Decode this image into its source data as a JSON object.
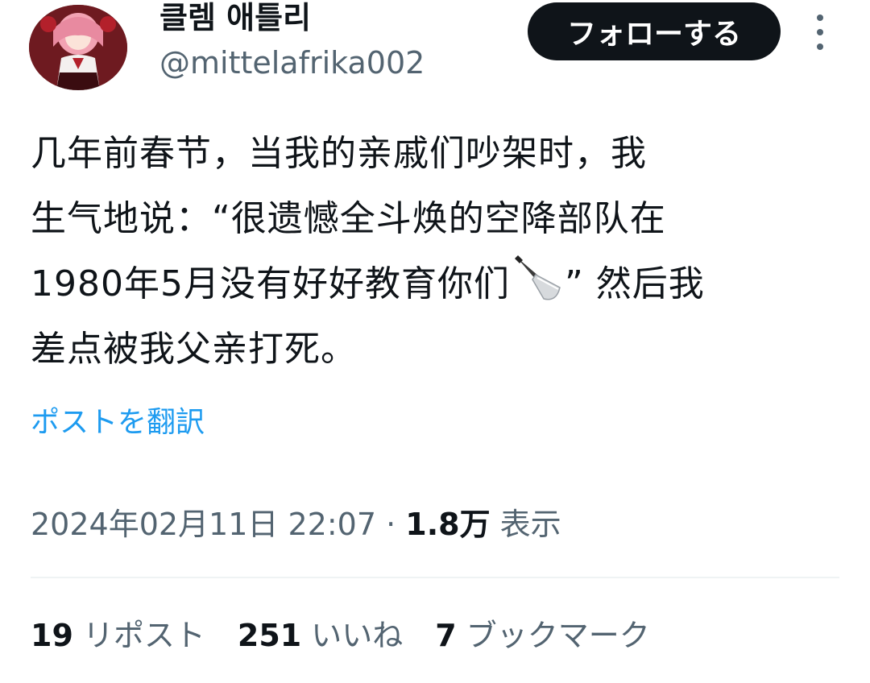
{
  "user": {
    "display_name": "클렘 애틀리",
    "handle": "@mittelafrika002",
    "avatar_icon": "anime-avatar"
  },
  "follow_button_label": "フォローする",
  "more_icon": "more-vertical-icon",
  "tweet": {
    "lines": [
      "几年前春节，当我的亲戚们吵架时，我",
      "生气地说：“很遗憾全斗焕的空降部队在",
      "1980年5月没有好好教育你们",
      "差点被我父亲打死。"
    ],
    "line3_after_emoji": "” 然后我",
    "emoji": "knife-icon"
  },
  "translate_link": "ポストを翻訳",
  "meta": {
    "datetime": "2024年02月11日 22:07",
    "separator": " · ",
    "views_count": "1.8万",
    "views_label": " 表示"
  },
  "stats": [
    {
      "count": "19",
      "label": "リポスト"
    },
    {
      "count": "251",
      "label": "いいね"
    },
    {
      "count": "7",
      "label": "ブックマーク"
    }
  ],
  "colors": {
    "text": "#0f1419",
    "secondary": "#536471",
    "link": "#1d9bf0",
    "button_bg": "#0f1419"
  }
}
